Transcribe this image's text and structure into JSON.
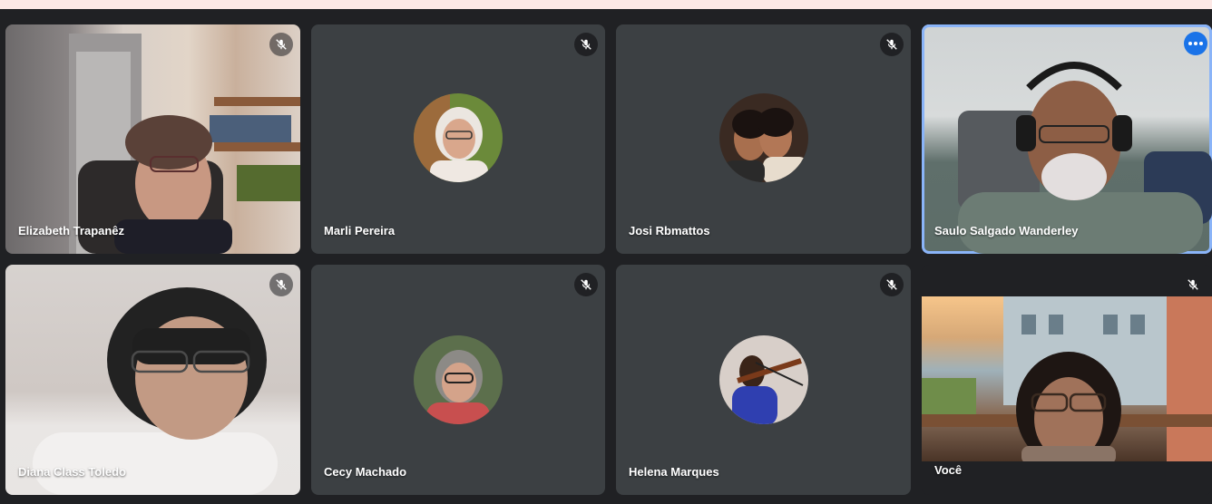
{
  "meeting": {
    "participants": [
      {
        "name": "Elizabeth Trapanêz",
        "muted": true,
        "video": true
      },
      {
        "name": "Marli Pereira",
        "muted": true,
        "video": false
      },
      {
        "name": "Josi Rbmattos",
        "muted": true,
        "video": false
      },
      {
        "name": "Saulo Salgado Wanderley",
        "muted": false,
        "video": true,
        "speaking": true
      },
      {
        "name": "Diana Class Toledo",
        "muted": true,
        "video": true
      },
      {
        "name": "Cecy Machado",
        "muted": true,
        "video": false
      },
      {
        "name": "Helena Marques",
        "muted": true,
        "video": false
      },
      {
        "name": "Você",
        "muted": true,
        "video": true
      }
    ]
  },
  "colors": {
    "background": "#202124",
    "tile": "#3c4043",
    "active_outline": "#8ab4f8",
    "menu_button": "#1a73e8",
    "top_banner": "#fce8e6"
  },
  "icons": {
    "muted": "mic-off-icon",
    "options": "more-options-icon"
  }
}
